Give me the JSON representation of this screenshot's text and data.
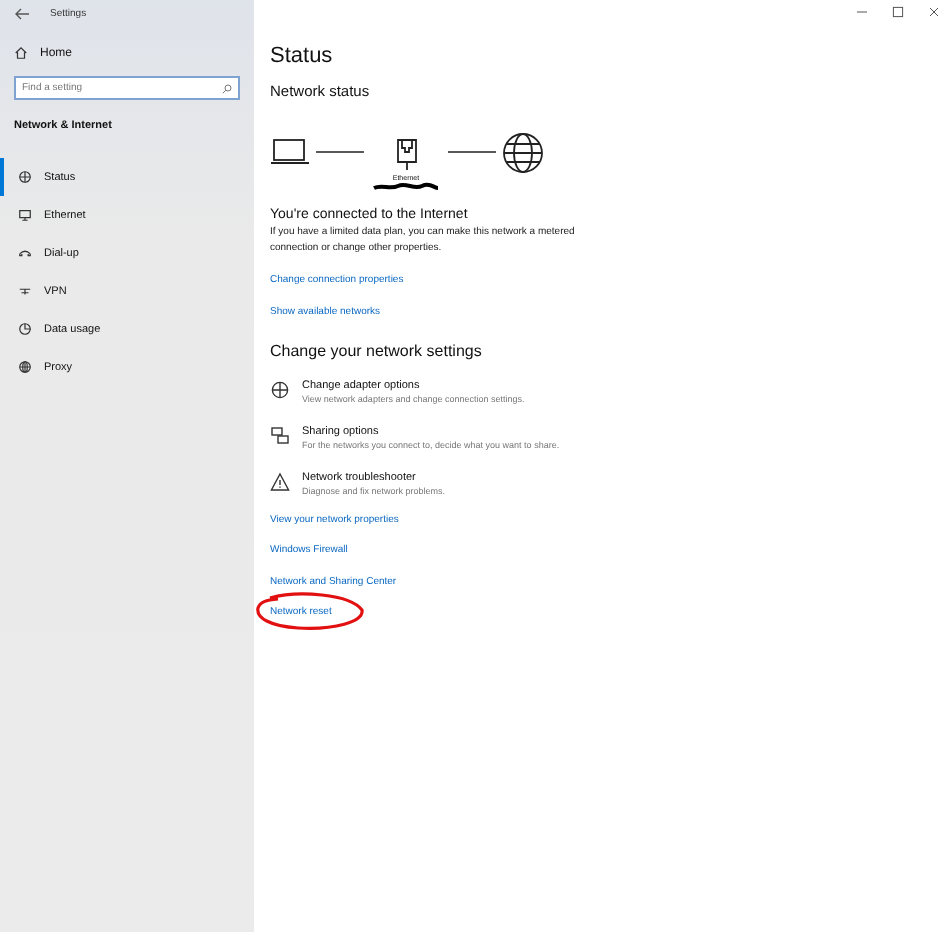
{
  "window": {
    "title": "Settings"
  },
  "sidebar": {
    "home": "Home",
    "search": {
      "placeholder": "Find a setting"
    },
    "section": "Network & Internet",
    "items": [
      {
        "label": "Status",
        "selected": true
      },
      {
        "label": "Ethernet",
        "selected": false
      },
      {
        "label": "Dial-up",
        "selected": false
      },
      {
        "label": "VPN",
        "selected": false
      },
      {
        "label": "Data usage",
        "selected": false
      },
      {
        "label": "Proxy",
        "selected": false
      }
    ]
  },
  "main": {
    "title": "Status",
    "network_status": {
      "heading": "Network status",
      "adapter_label": "Ethernet"
    },
    "connection": {
      "heading": "You're connected to the Internet",
      "description": "If you have a limited data plan, you can make this network a metered connection or change other properties."
    },
    "links": [
      "Change connection properties",
      "Show available networks"
    ],
    "change_heading": "Change your network settings",
    "options": [
      {
        "title": "Change adapter options",
        "description": "View network adapters and change connection settings."
      },
      {
        "title": "Sharing options",
        "description": "For the networks you connect to, decide what you want to share."
      },
      {
        "title": "Network troubleshooter",
        "description": "Diagnose and fix network problems."
      }
    ],
    "more_links": [
      {
        "label": "View your network properties",
        "circled": false
      },
      {
        "label": "Windows Firewall",
        "circled": false
      },
      {
        "label": "Network and Sharing Center",
        "circled": false
      },
      {
        "label": "Network reset",
        "circled": true
      }
    ]
  }
}
